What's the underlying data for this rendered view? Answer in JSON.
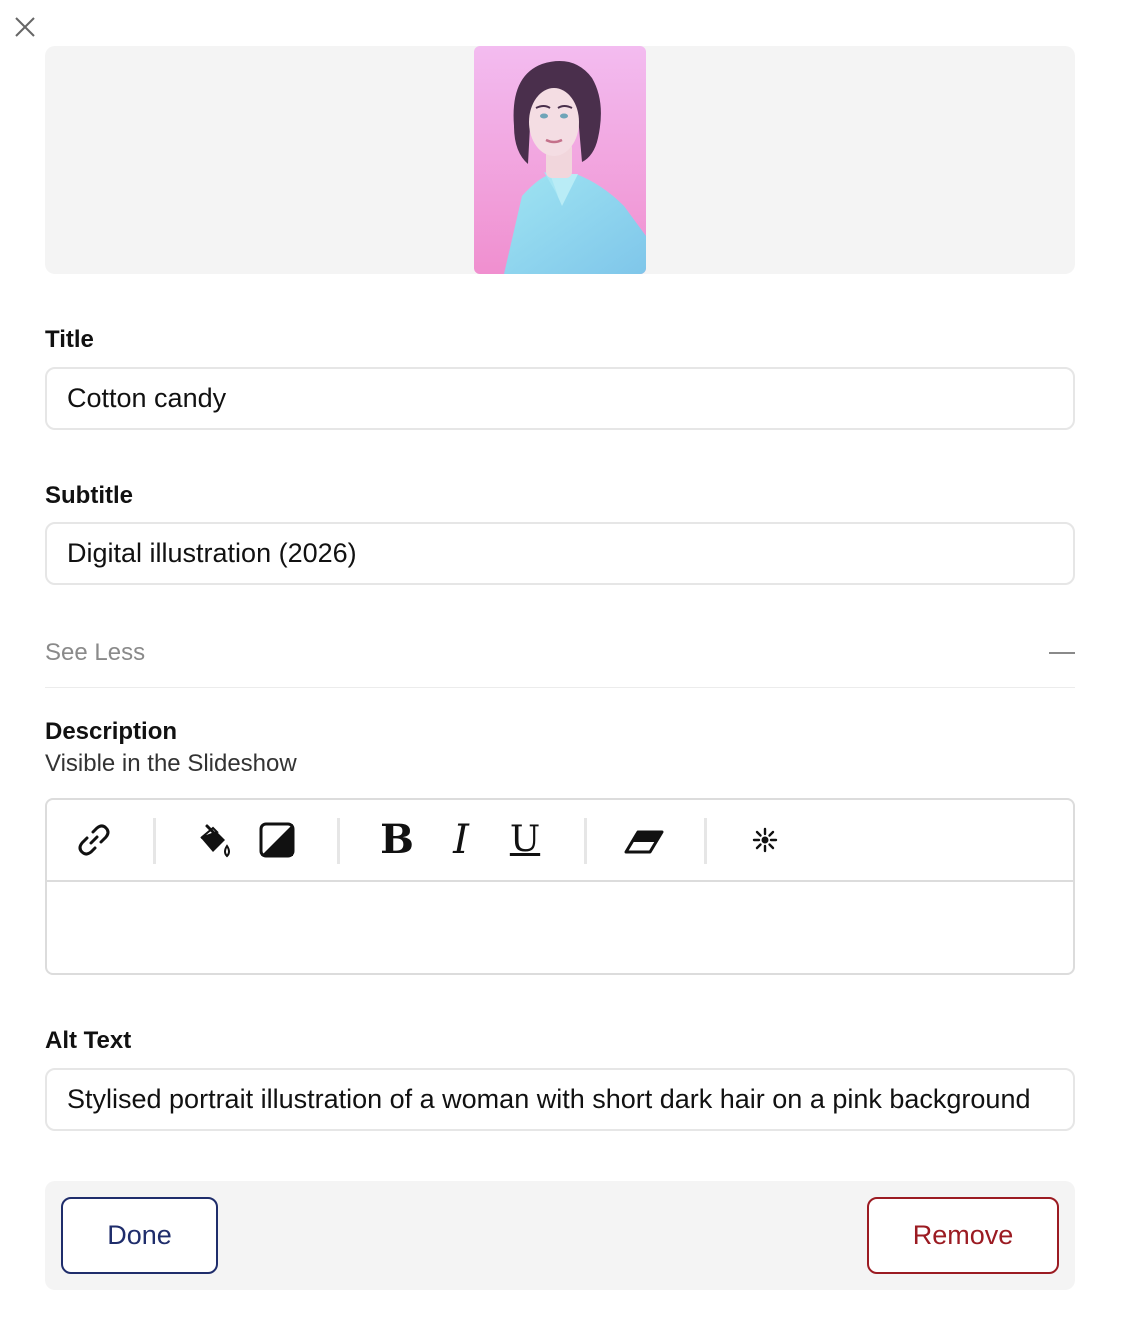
{
  "preview": {
    "image_alt": "Cotton candy portrait thumbnail"
  },
  "form": {
    "title_label": "Title",
    "title_value": "Cotton candy",
    "subtitle_label": "Subtitle",
    "subtitle_value": "Digital illustration (2026)",
    "toggle_label": "See Less",
    "description_label": "Description",
    "description_hint": "Visible in the Slideshow",
    "description_value": "",
    "alt_label": "Alt Text",
    "alt_value": "Stylised portrait illustration of a woman with short dark hair on a pink background"
  },
  "toolbar": {
    "bold": "B",
    "italic": "I",
    "underline": "U",
    "icons": [
      "link-icon",
      "fill-color-icon",
      "contrast-icon",
      "eraser-icon",
      "sparkle-icon"
    ]
  },
  "actions": {
    "done_label": "Done",
    "remove_label": "Remove"
  },
  "colors": {
    "done": "#1f2d6b",
    "remove": "#9b1b22",
    "thumb_bg": "#f2b6ea",
    "shirt": "#8fd8ee"
  }
}
